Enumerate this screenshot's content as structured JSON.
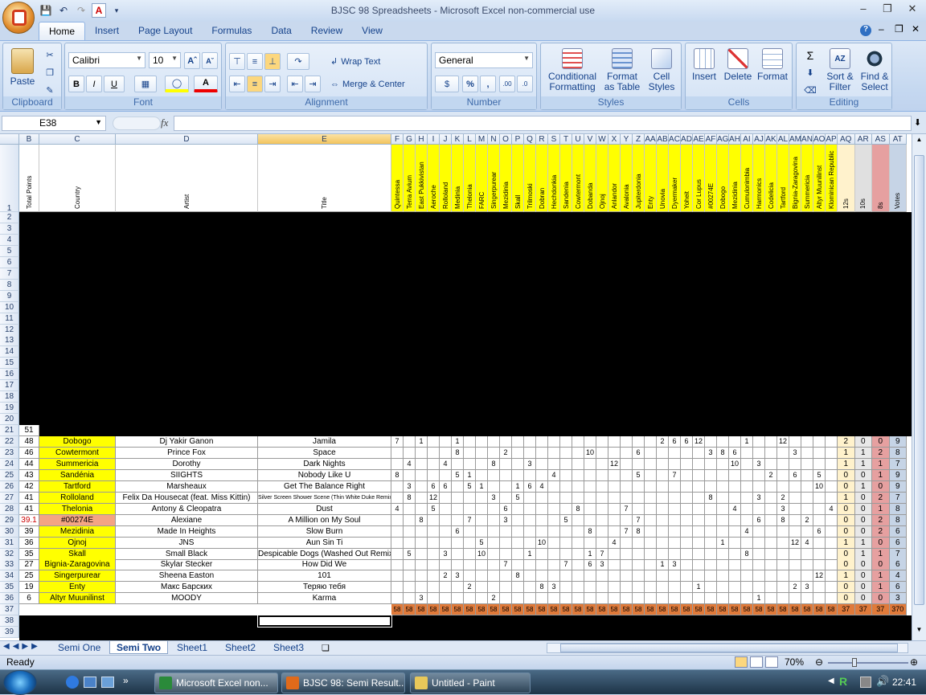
{
  "window": {
    "title": "BJSC 98 Spreadsheets - Microsoft Excel non-commercial use"
  },
  "tabs": [
    "Home",
    "Insert",
    "Page Layout",
    "Formulas",
    "Data",
    "Review",
    "View"
  ],
  "ribbon": {
    "clipboard": {
      "paste": "Paste",
      "label": "Clipboard"
    },
    "font": {
      "name": "Calibri",
      "size": "10",
      "bold": "B",
      "italic": "I",
      "underline": "U",
      "label": "Font"
    },
    "alignment": {
      "wrap": "Wrap Text",
      "merge": "Merge & Center",
      "label": "Alignment"
    },
    "number": {
      "format": "General",
      "percent": "%",
      "comma": ",",
      "label": "Number"
    },
    "styles": {
      "conditional": "Conditional Formatting",
      "format_table": "Format as Table",
      "cell_styles": "Cell Styles",
      "label": "Styles"
    },
    "cells": {
      "insert": "Insert",
      "delete": "Delete",
      "format": "Format",
      "label": "Cells"
    },
    "editing": {
      "sort": "Sort & Filter",
      "find": "Find & Select",
      "label": "Editing"
    }
  },
  "namebox": "E38",
  "fx": "fx",
  "columns": [
    "B",
    "C",
    "D",
    "E",
    "F",
    "G",
    "H",
    "I",
    "J",
    "K",
    "L",
    "M",
    "N",
    "O",
    "P",
    "Q",
    "R",
    "S",
    "T",
    "U",
    "V",
    "W",
    "X",
    "Y",
    "Z",
    "AA",
    "AB",
    "AC",
    "AD",
    "AE",
    "AF",
    "AG",
    "AH",
    "AI",
    "AJ",
    "AK",
    "AL",
    "AM",
    "AN",
    "AO",
    "AP",
    "AQ",
    "AR",
    "AS",
    "AT"
  ],
  "headers": {
    "B": "Total Points",
    "C": "Country",
    "D": "Artist",
    "E": "Title",
    "voters": [
      "Quintessa",
      "Terra Avium",
      "East Pukkivistan",
      "Aeroche",
      "Rolloland",
      "Medinia",
      "Thelonia",
      "FARC",
      "Singerpurear",
      "Mezidinia",
      "Skall",
      "Trilmoski",
      "Dobran",
      "Hechdonkia",
      "Sandenia",
      "Cowtermont",
      "Dobanda",
      "Ojnoj",
      "Anlandor",
      "Avalonia",
      "Jupiterdonia",
      "Enty",
      "Unovia",
      "Dyermaker",
      "Yoheit",
      "Cor Lupus",
      "#00274E",
      "Dobogo",
      "Mezidinia",
      "Cumulonimbia",
      "Harmonics",
      "Codelicia",
      "Tartford",
      "Bignia-Zaragovina",
      "Summericia",
      "Altyr Muunilinst",
      "Klominican Republic"
    ],
    "AQ": "12s",
    "AR": "10s",
    "AS": "8s",
    "AT": "Votes"
  },
  "row21": {
    "total": "51"
  },
  "rows": [
    {
      "r": "22",
      "total": "48",
      "country": "Dobogo",
      "artist": "Dj Yakir Ganon",
      "title": "Jamila",
      "p": {
        "F": "7",
        "H": "1",
        "K": "1",
        "AB": "2",
        "AC": "6",
        "AD": "6",
        "AE": "12",
        "AI": "1",
        "AL": "12"
      },
      "AQ": "2",
      "AR": "0",
      "AS": "0",
      "AT": "9"
    },
    {
      "r": "23",
      "total": "46",
      "country": "Cowtermont",
      "artist": "Prince Fox",
      "title": "Space",
      "p": {
        "K": "8",
        "O": "2",
        "V": "10",
        "Z": "6",
        "AF": "3",
        "AG": "8",
        "AH": "6",
        "AM": "3"
      },
      "AQ": "1",
      "AR": "1",
      "AS": "2",
      "AT": "8"
    },
    {
      "r": "24",
      "total": "44",
      "country": "Summericia",
      "artist": "Dorothy",
      "title": "Dark Nights",
      "p": {
        "G": "4",
        "J": "4",
        "N": "8",
        "Q": "3",
        "X": "12",
        "AH": "10",
        "AJ": "3"
      },
      "AQ": "1",
      "AR": "1",
      "AS": "1",
      "AT": "7"
    },
    {
      "r": "25",
      "total": "43",
      "country": "Sandénia",
      "artist": "SIIGHTS",
      "title": "Nobody Like U",
      "p": {
        "F": "8",
        "K": "5",
        "L": "1",
        "S": "4",
        "Z": "5",
        "AC": "7",
        "AK": "2",
        "AM": "6",
        "AO": "5"
      },
      "AQ": "0",
      "AR": "0",
      "AS": "1",
      "AT": "9"
    },
    {
      "r": "26",
      "total": "42",
      "country": "Tartford",
      "artist": "Marsheaux",
      "title": "Get The Balance Right",
      "p": {
        "G": "3",
        "I": "6",
        "J": "6",
        "L": "5",
        "M": "1",
        "P": "1",
        "Q": "6",
        "R": "4",
        "AO": "10"
      },
      "AQ": "0",
      "AR": "1",
      "AS": "0",
      "AT": "9"
    },
    {
      "r": "27",
      "total": "41",
      "country": "Rolloland",
      "artist": "Felix Da Housecat (feat. Miss Kittin)",
      "title": "Silver Screen Shower Scene (Thin White Duke Remix)",
      "p": {
        "G": "8",
        "I": "12",
        "N": "3",
        "P": "5",
        "AF": "8",
        "AJ": "3",
        "AL": "2"
      },
      "AQ": "1",
      "AR": "0",
      "AS": "2",
      "AT": "7"
    },
    {
      "r": "28",
      "total": "41",
      "country": "Thelonia",
      "artist": "Antony & Cleopatra",
      "title": "Dust",
      "p": {
        "F": "4",
        "I": "5",
        "O": "6",
        "U": "8",
        "Y": "7",
        "AH": "4",
        "AL": "3",
        "AP": "4"
      },
      "AQ": "0",
      "AR": "0",
      "AS": "1",
      "AT": "8"
    },
    {
      "r": "29",
      "total": "39.1",
      "country": "#00274E",
      "artist": "Alexiane",
      "title": "A Million on My Soul",
      "p": {
        "H": "8",
        "L": "7",
        "O": "3",
        "T": "5",
        "Z": "7",
        "AJ": "6",
        "AL": "8",
        "AN": "2"
      },
      "AQ": "0",
      "AR": "0",
      "AS": "2",
      "AT": "8"
    },
    {
      "r": "30",
      "total": "39",
      "country": "Mezidinia",
      "artist": "Made In Heights",
      "title": "Slow Burn",
      "p": {
        "K": "6",
        "V": "8",
        "Y": "7",
        "Z": "8",
        "AI": "4",
        "AO": "6"
      },
      "AQ": "0",
      "AR": "0",
      "AS": "2",
      "AT": "6"
    },
    {
      "r": "31",
      "total": "36",
      "country": "Ojnoj",
      "artist": "JNS",
      "title": "Aun Sin Ti",
      "p": {
        "M": "5",
        "R": "10",
        "X": "4",
        "AG": "1",
        "AM": "12",
        "AN": "4"
      },
      "AQ": "1",
      "AR": "1",
      "AS": "0",
      "AT": "6"
    },
    {
      "r": "32",
      "total": "35",
      "country": "Skall",
      "artist": "Small Black",
      "title": "Despicable Dogs (Washed Out Remix)",
      "p": {
        "G": "5",
        "J": "3",
        "M": "10",
        "Q": "1",
        "V": "1",
        "W": "7",
        "AI": "8"
      },
      "AQ": "0",
      "AR": "1",
      "AS": "1",
      "AT": "7"
    },
    {
      "r": "33",
      "total": "27",
      "country": "Bignia-Zaragovina",
      "artist": "Skylar Stecker",
      "title": "How Did We",
      "p": {
        "O": "7",
        "T": "7",
        "V": "6",
        "W": "3",
        "AB": "1",
        "AC": "3"
      },
      "AQ": "0",
      "AR": "0",
      "AS": "0",
      "AT": "6"
    },
    {
      "r": "34",
      "total": "25",
      "country": "Singerpurear",
      "artist": "Sheena Easton",
      "title": "101",
      "p": {
        "J": "2",
        "K": "3",
        "P": "8",
        "AO": "12"
      },
      "AQ": "1",
      "AR": "0",
      "AS": "1",
      "AT": "4"
    },
    {
      "r": "35",
      "total": "19",
      "country": "Enty",
      "artist": "Макс Барских",
      "title": "Теряю тебя",
      "p": {
        "L": "2",
        "R": "8",
        "S": "3",
        "AE": "1",
        "AM": "2",
        "AN": "3"
      },
      "AQ": "0",
      "AR": "0",
      "AS": "1",
      "AT": "6"
    },
    {
      "r": "36",
      "total": "6",
      "country": "Altyr Muunilinst",
      "artist": "MOODY",
      "title": "Karma",
      "p": {
        "H": "3",
        "N": "2",
        "AJ": "1"
      },
      "AQ": "0",
      "AR": "0",
      "AS": "0",
      "AT": "3"
    }
  ],
  "row37": {
    "voter_total": "58",
    "AQ": "37",
    "AR": "37",
    "AS": "37",
    "AT": "370"
  },
  "sheets": [
    "Semi One",
    "Semi Two",
    "Sheet1",
    "Sheet2",
    "Sheet3"
  ],
  "status": {
    "ready": "Ready",
    "zoom": "70%"
  },
  "taskbar": {
    "items": [
      "Microsoft Excel non...",
      "BJSC 98: Semi Result...",
      "Untitled - Paint"
    ],
    "clock": "22:41"
  }
}
